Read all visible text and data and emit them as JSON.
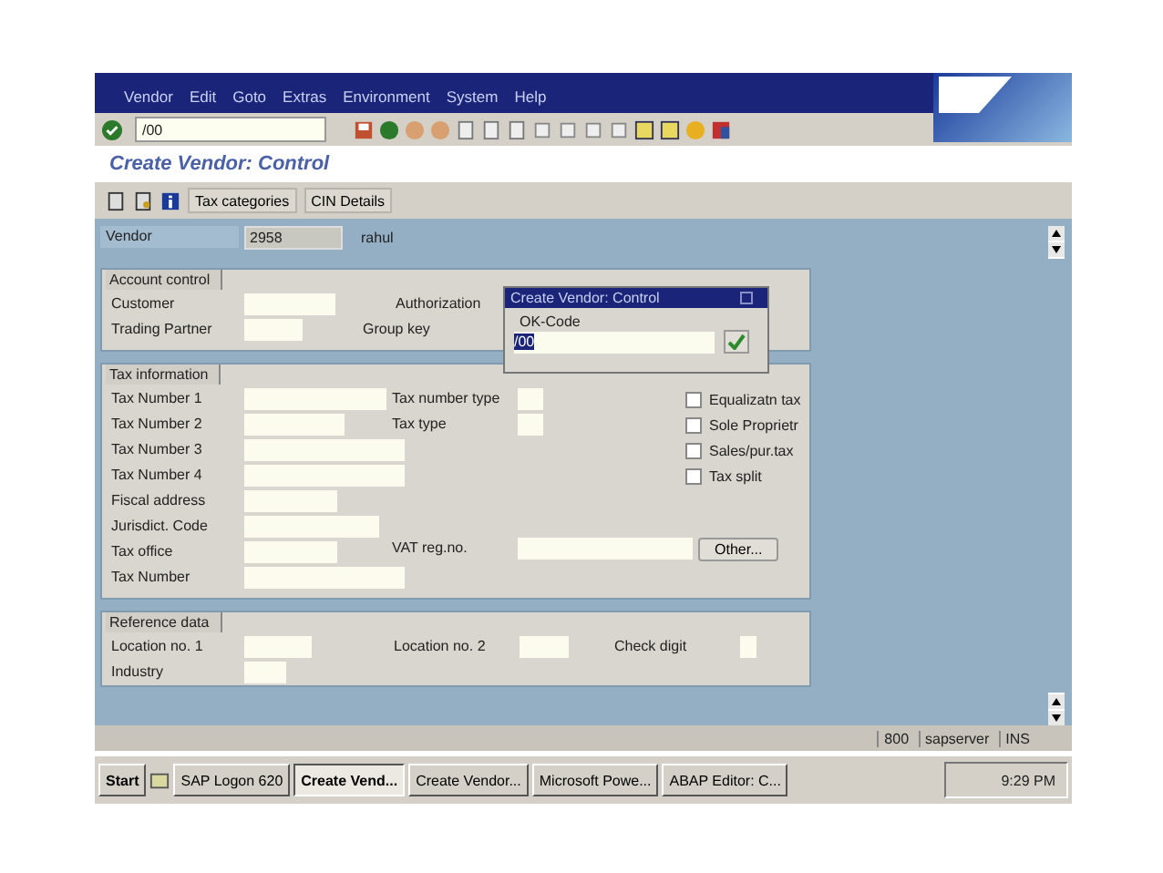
{
  "menu": [
    "Vendor",
    "Edit",
    "Goto",
    "Extras",
    "Environment",
    "System",
    "Help"
  ],
  "command_field": {
    "value": "/00"
  },
  "title": "Create Vendor: Control",
  "app_toolbar": [
    "Tax categories",
    "CIN Details"
  ],
  "vendor": {
    "label": "Vendor",
    "number": "2958",
    "name": "rahul"
  },
  "account_control": {
    "title": "Account control",
    "fields": [
      "Customer",
      "Authorization",
      "Trading Partner",
      "Group key"
    ]
  },
  "dialog": {
    "title": "Create Vendor: Control",
    "label": "OK-Code",
    "value": "/00"
  },
  "tax_information": {
    "title": "Tax information",
    "fields": [
      "Tax Number 1",
      "Tax Number 2",
      "Tax Number 3",
      "Tax Number 4",
      "Fiscal address",
      "Jurisdict. Code",
      "Tax office",
      "Tax Number"
    ],
    "middle_fields": [
      "Tax number type",
      "Tax type",
      "VAT reg.no."
    ],
    "checkboxes": [
      {
        "label": "Equalizatn tax",
        "checked": false
      },
      {
        "label": "Sole Proprietr",
        "checked": false
      },
      {
        "label": "Sales/pur.tax",
        "checked": false
      },
      {
        "label": "Tax split",
        "checked": false
      }
    ],
    "button": "Other..."
  },
  "reference_data": {
    "title": "Reference data",
    "fields": [
      "Location no. 1",
      "Location no. 2",
      "Check digit",
      "Industry"
    ]
  },
  "status_bar": {
    "client": "800",
    "server": "sapserver",
    "mode": "INS"
  },
  "taskbar": {
    "start": "Start",
    "tasks": [
      {
        "label": "SAP Logon 620",
        "selected": false
      },
      {
        "label": "Create Vend...",
        "selected": true
      },
      {
        "label": "Create Vendor...",
        "selected": false
      },
      {
        "label": "Microsoft Powe...",
        "selected": false
      },
      {
        "label": "ABAP Editor: C...",
        "selected": false
      }
    ],
    "clock": "9:29 PM"
  }
}
